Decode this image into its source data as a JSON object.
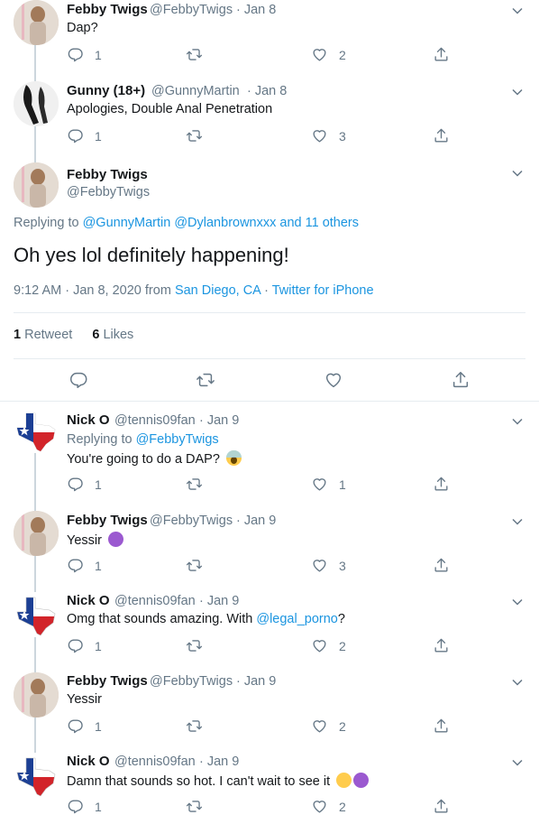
{
  "tweets_top": [
    {
      "name": "Febby Twigs",
      "handle": "@FebbyTwigs",
      "time": "· Jan 8",
      "text": "Dap?",
      "reply": "1",
      "retweet": "",
      "like": "2"
    },
    {
      "name": "Gunny (18+)",
      "handle": "@GunnyMartin",
      "time": "· Jan 8",
      "text": "Apologies, Double Anal Penetration",
      "reply": "1",
      "retweet": "",
      "like": "3"
    }
  ],
  "main": {
    "name": "Febby Twigs",
    "handle": "@FebbyTwigs",
    "replying_prefix": "Replying to ",
    "replying_users": "@GunnyMartin @Dylanbrownxxx",
    "replying_and": " and ",
    "replying_others": "11 others",
    "text": "Oh yes lol definitely happening!",
    "timestamp": "9:12 AM · Jan 8, 2020 from ",
    "location": "San Diego, CA",
    "sep": " · ",
    "source": "Twitter for iPhone",
    "retweets_count": "1",
    "retweets_label": "Retweet",
    "likes_count": "6",
    "likes_label": "Likes"
  },
  "replies": [
    {
      "name": "Nick O",
      "handle": "@tennis09fan",
      "time": "· Jan 9",
      "replying_prefix": "Replying to ",
      "replying_user": "@FebbyTwigs",
      "text": "You're going to do a DAP?",
      "emoji": "scream-emoji",
      "reply": "1",
      "retweet": "",
      "like": "1"
    },
    {
      "name": "Febby Twigs",
      "handle": "@FebbyTwigs",
      "time": "· Jan 9",
      "text": "Yessir",
      "emoji": "devil-emoji",
      "reply": "1",
      "retweet": "",
      "like": "3"
    },
    {
      "name": "Nick O",
      "handle": "@tennis09fan",
      "time": "· Jan 9",
      "text_before": "Omg that sounds amazing. With ",
      "mention": "@legal_porno",
      "text_after": "?",
      "reply": "1",
      "retweet": "",
      "like": "2"
    },
    {
      "name": "Febby Twigs",
      "handle": "@FebbyTwigs",
      "time": "· Jan 9",
      "text": "Yessir",
      "reply": "1",
      "retweet": "",
      "like": "2"
    },
    {
      "name": "Nick O",
      "handle": "@tennis09fan",
      "time": "· Jan 9",
      "text": "Damn that sounds so hot. I can't wait to see it",
      "emoji": "relieved-emoji devil-emoji",
      "reply": "1",
      "retweet": "",
      "like": "2"
    }
  ],
  "colors": {
    "accent": "#1b95e0",
    "muted": "#657786",
    "text": "#14171a",
    "border": "#e6ecf0"
  },
  "icons": [
    "reply-icon",
    "retweet-icon",
    "like-icon",
    "share-icon",
    "chevron-down-icon"
  ]
}
